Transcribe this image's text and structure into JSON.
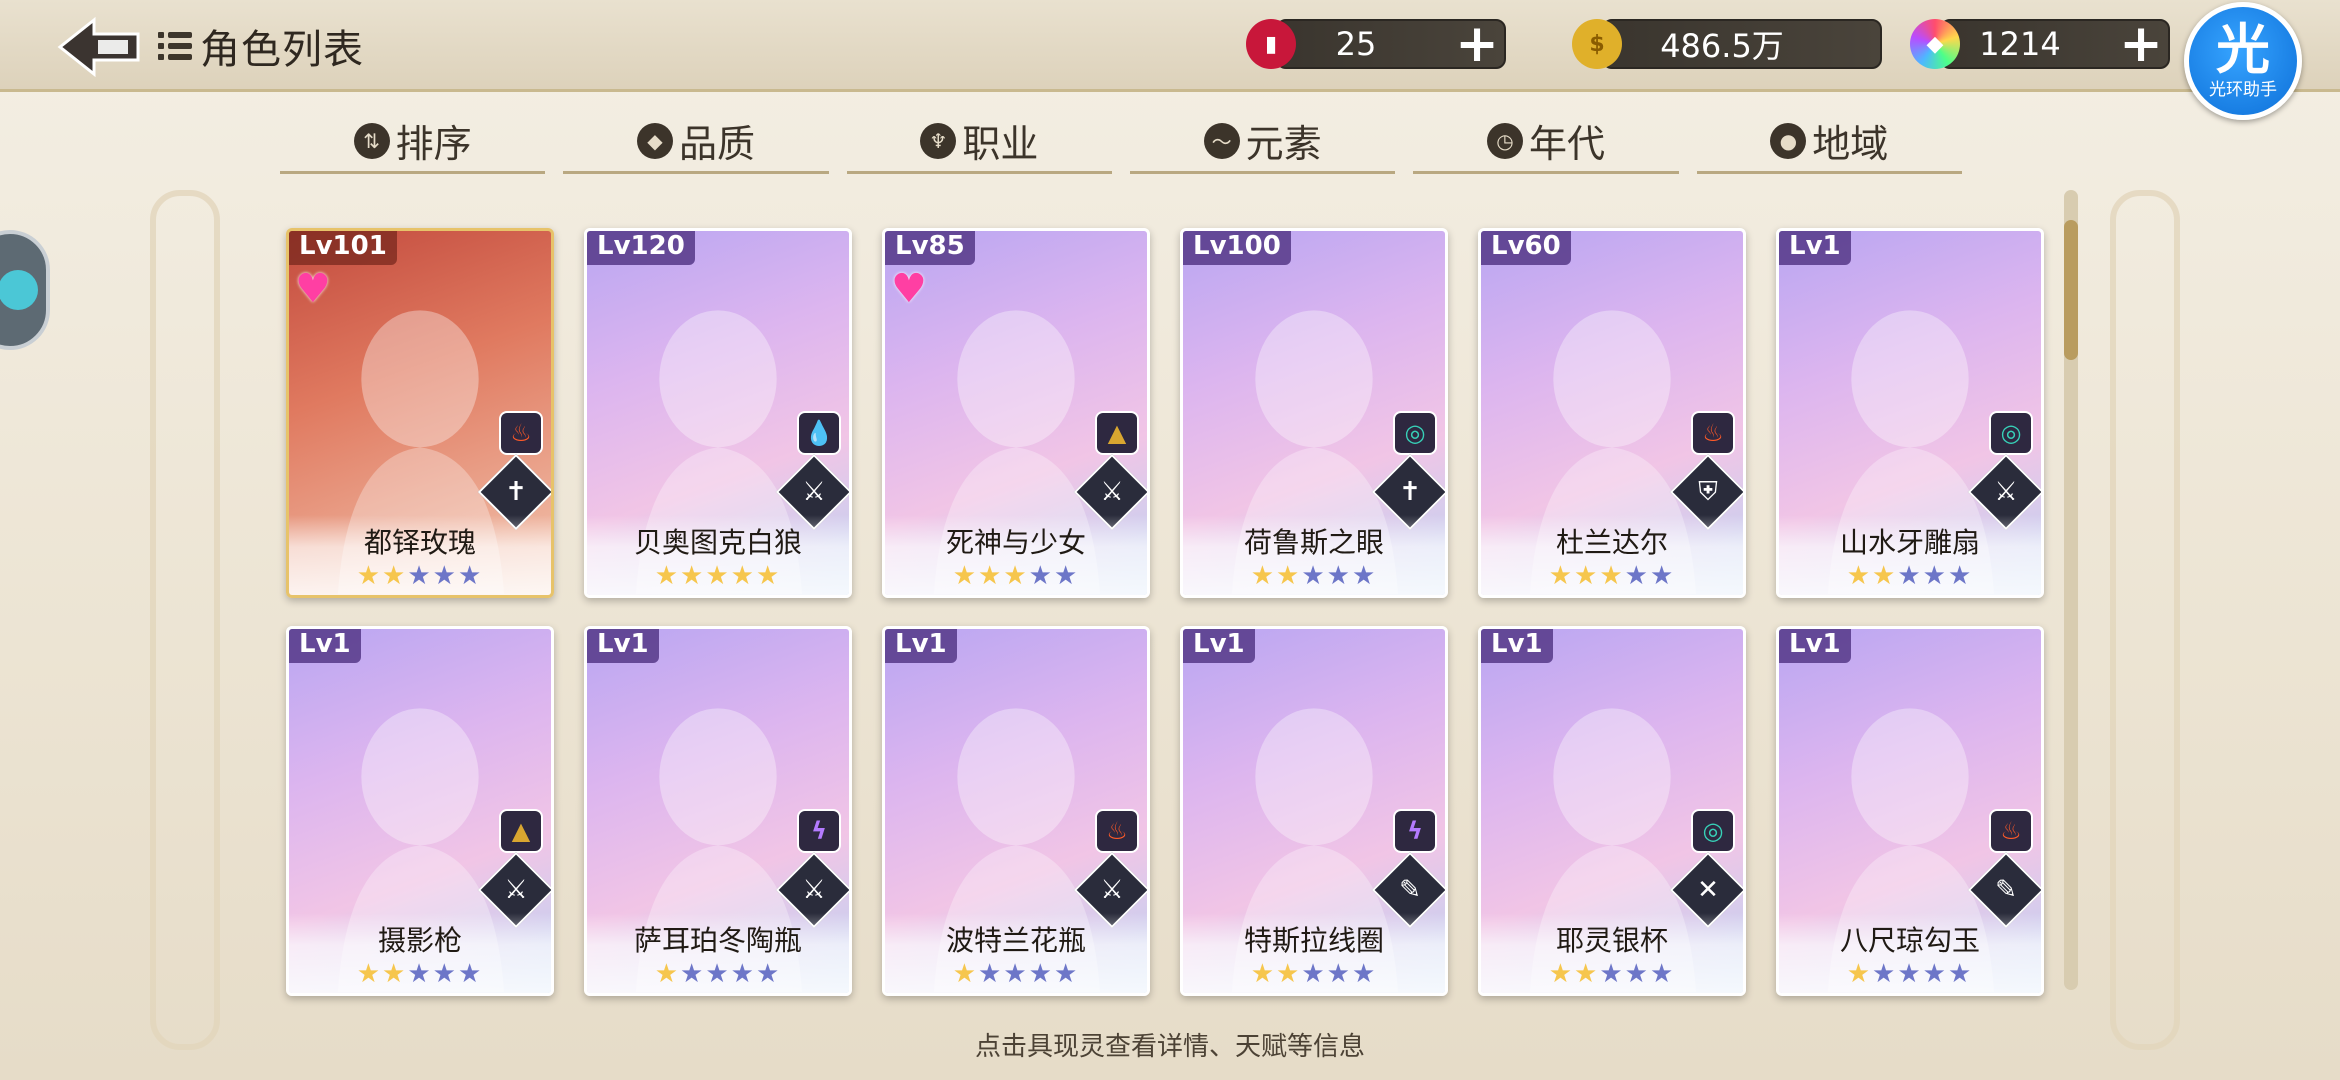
{
  "header": {
    "title": "角色列表",
    "resources": [
      {
        "name": "stamina",
        "value": "25",
        "icon": "soda-can-icon",
        "color": "#c8173a"
      },
      {
        "name": "gold",
        "value": "486.5万",
        "icon": "gold-coin-icon",
        "color": "#e0b02a"
      },
      {
        "name": "gem",
        "value": "1214",
        "icon": "rainbow-gem-icon",
        "color": "#9b59ff"
      }
    ],
    "assistant": {
      "big": "光",
      "small": "光环助手"
    }
  },
  "tabs": [
    {
      "label": "排序",
      "icon": "sort-icon",
      "glyph": "⇅"
    },
    {
      "label": "品质",
      "icon": "gem-icon",
      "glyph": "◆"
    },
    {
      "label": "职业",
      "icon": "job-icon",
      "glyph": "♆"
    },
    {
      "label": "元素",
      "icon": "element-icon",
      "glyph": "〜"
    },
    {
      "label": "年代",
      "icon": "era-icon",
      "glyph": "◷"
    },
    {
      "label": "地域",
      "icon": "location-pin-icon",
      "glyph": "●"
    }
  ],
  "cards": [
    {
      "lv": "Lv101",
      "name": "都铎玫瑰",
      "heart": true,
      "element": "fire",
      "element_color": "#ff5a28",
      "element_glyph": "♨",
      "class_glyph": "✝",
      "stars_on": 2,
      "stars_total": 5,
      "gold": true
    },
    {
      "lv": "Lv120",
      "name": "贝奥图克白狼",
      "heart": false,
      "element": "water",
      "element_color": "#3aa0ff",
      "element_glyph": "💧",
      "class_glyph": "⚔",
      "stars_on": 5,
      "stars_total": 5,
      "gold": false
    },
    {
      "lv": "Lv85",
      "name": "死神与少女",
      "heart": true,
      "element": "earth",
      "element_color": "#d9a630",
      "element_glyph": "▲",
      "class_glyph": "⚔",
      "stars_on": 3,
      "stars_total": 5,
      "gold": false
    },
    {
      "lv": "Lv100",
      "name": "荷鲁斯之眼",
      "heart": false,
      "element": "wind",
      "element_color": "#37d0b7",
      "element_glyph": "◎",
      "class_glyph": "✝",
      "stars_on": 2,
      "stars_total": 5,
      "gold": false
    },
    {
      "lv": "Lv60",
      "name": "杜兰达尔",
      "heart": false,
      "element": "fire",
      "element_color": "#ff5a28",
      "element_glyph": "♨",
      "class_glyph": "⛨",
      "stars_on": 3,
      "stars_total": 5,
      "gold": false
    },
    {
      "lv": "Lv1",
      "name": "山水牙雕扇",
      "heart": false,
      "element": "wind",
      "element_color": "#37d0b7",
      "element_glyph": "◎",
      "class_glyph": "⚔",
      "stars_on": 2,
      "stars_total": 5,
      "gold": false
    },
    {
      "lv": "Lv1",
      "name": "摄影枪",
      "heart": false,
      "element": "earth",
      "element_color": "#d9a630",
      "element_glyph": "▲",
      "class_glyph": "⚔",
      "stars_on": 2,
      "stars_total": 5,
      "gold": false
    },
    {
      "lv": "Lv1",
      "name": "萨耳珀冬陶瓶",
      "heart": false,
      "element": "thunder",
      "element_color": "#b47bff",
      "element_glyph": "ϟ",
      "class_glyph": "⚔",
      "stars_on": 1,
      "stars_total": 5,
      "gold": false
    },
    {
      "lv": "Lv1",
      "name": "波特兰花瓶",
      "heart": false,
      "element": "fire",
      "element_color": "#ff5a28",
      "element_glyph": "♨",
      "class_glyph": "⚔",
      "stars_on": 1,
      "stars_total": 5,
      "gold": false
    },
    {
      "lv": "Lv1",
      "name": "特斯拉线圈",
      "heart": false,
      "element": "thunder",
      "element_color": "#b47bff",
      "element_glyph": "ϟ",
      "class_glyph": "✎",
      "stars_on": 2,
      "stars_total": 5,
      "gold": false
    },
    {
      "lv": "Lv1",
      "name": "耶灵银杯",
      "heart": false,
      "element": "wind",
      "element_color": "#37d0b7",
      "element_glyph": "◎",
      "class_glyph": "✕",
      "stars_on": 2,
      "stars_total": 5,
      "gold": false
    },
    {
      "lv": "Lv1",
      "name": "八尺琼勾玉",
      "heart": false,
      "element": "fire",
      "element_color": "#ff5a28",
      "element_glyph": "♨",
      "class_glyph": "✎",
      "stars_on": 1,
      "stars_total": 5,
      "gold": false
    }
  ],
  "footer": {
    "hint": "点击具现灵查看详情、天赋等信息"
  }
}
